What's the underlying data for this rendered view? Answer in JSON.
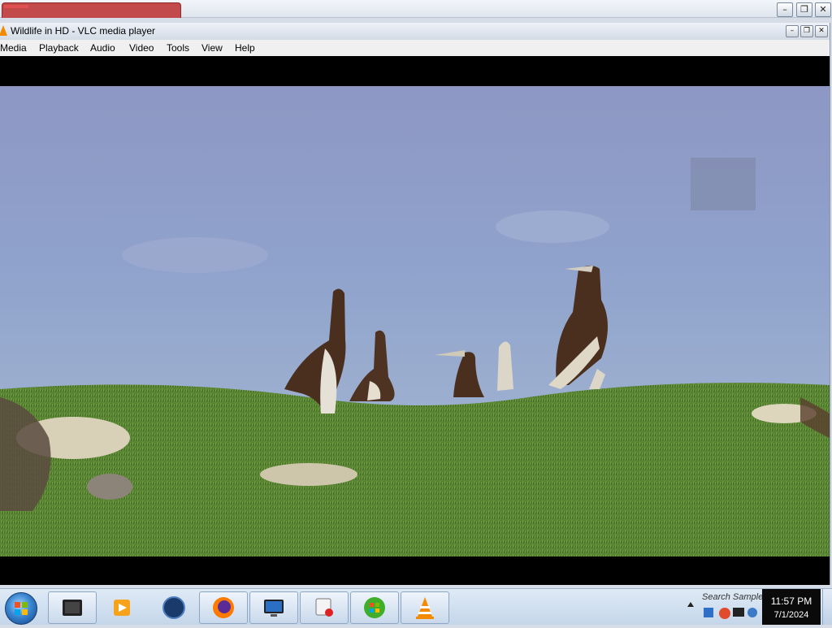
{
  "window": {
    "title": "Wildlife in HD - VLC media player",
    "min_glyph": "–",
    "max_glyph": "❐",
    "close_glyph": "✕"
  },
  "menu": {
    "items": [
      "Media",
      "Playback",
      "Audio",
      "Video",
      "Tools",
      "View",
      "Help"
    ]
  },
  "taskbar": {
    "search_text": "Search Sample",
    "time": "11:57 PM",
    "date": "7/1/2024",
    "apps": [
      "media-app-icon",
      "media-player-icon",
      "globe-icon",
      "firefox-icon",
      "monitor-icon",
      "recorder-icon",
      "windows-media-icon",
      "vlc-icon"
    ]
  },
  "colors": {
    "sky": "#8f9bc4",
    "grass": "#4f7a2c",
    "vlc_orange": "#f38a00"
  }
}
